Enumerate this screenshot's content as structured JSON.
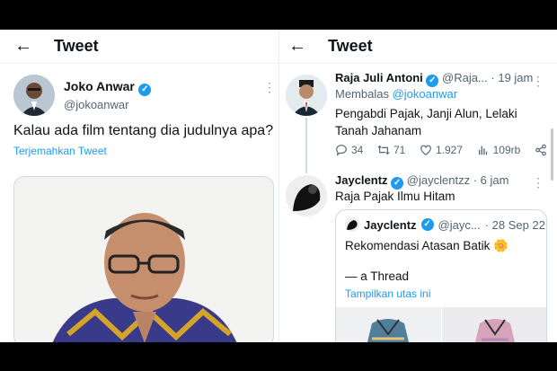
{
  "left": {
    "header": {
      "title": "Tweet"
    },
    "tweet": {
      "name": "Joko Anwar",
      "handle": "@jokoanwar",
      "text": "Kalau ada film tentang dia judulnya apa?",
      "translate_label": "Terjemahkan Tweet"
    }
  },
  "right": {
    "header": {
      "title": "Tweet"
    },
    "tweet1": {
      "name": "Raja Juli Antoni",
      "handle": "@Raja...",
      "time": "· 19 jam",
      "reply_prefix": "Membalas ",
      "reply_handle": "@jokoanwar",
      "text": "Pengabdi Pajak, Janji Alun, Lelaki Tanah Jahanam",
      "stats": {
        "replies": "34",
        "retweets": "71",
        "likes": "1.927",
        "views": "109rb"
      }
    },
    "tweet2": {
      "name": "Jayclentz",
      "handle": "@jayclentzz",
      "time": "· 6 jam",
      "text": "Raja Pajak Ilmu Hitam",
      "quote": {
        "name": "Jayclentz",
        "handle": "@jayc...",
        "time": "· 28 Sep 22",
        "text": "Rekomendasi Atasan Batik",
        "emoji": "🌼",
        "subtext": "— a Thread",
        "link": "Tampilkan utas ini"
      }
    }
  },
  "colors": {
    "accent": "#1d9bf0",
    "muted": "#536471",
    "border": "#cfd9de"
  },
  "icons": [
    "back-arrow-icon",
    "verified-badge-icon",
    "more-dots-icon",
    "reply-icon",
    "retweet-icon",
    "like-icon",
    "views-icon",
    "share-icon"
  ]
}
